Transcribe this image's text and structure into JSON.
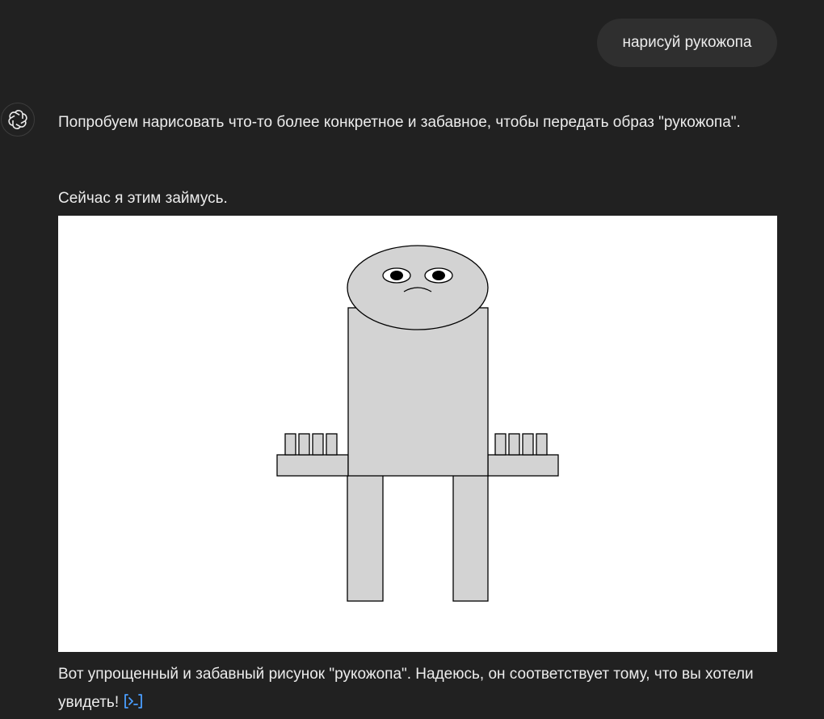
{
  "user_message": {
    "text": "нарисуй рукожопа"
  },
  "assistant": {
    "paragraph_1": "Попробуем нарисовать что-то более конкретное и забавное, чтобы передать образ \"рукожопа\".",
    "paragraph_2": "Сейчас я этим займусь.",
    "paragraph_3": "Вот упрощенный и забавный рисунок \"рукожопа\". Надеюсь, он соответствует тому, что вы хотели увидеть!",
    "code_link_icon": "code-icon"
  },
  "avatar_icon": "chatgpt-logo-icon",
  "figure": {
    "fill_color": "#d3d3d3",
    "stroke_color": "#000000",
    "background_color": "#ffffff"
  },
  "colors": {
    "background": "#212121",
    "user_bubble": "#2f2f2f",
    "text": "#ececec",
    "link_accent": "#4a9eff"
  }
}
